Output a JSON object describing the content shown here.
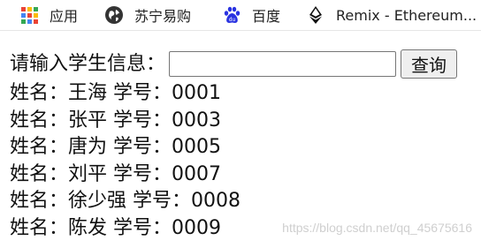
{
  "bookmarks": [
    {
      "icon": "apps-grid-icon",
      "label": "应用"
    },
    {
      "icon": "globe-icon",
      "label": "苏宁易购"
    },
    {
      "icon": "baidu-paw-icon",
      "label": "百度"
    },
    {
      "icon": "remix-icon",
      "label": "Remix - Ethereum..."
    }
  ],
  "form": {
    "label": "请输入学生信息：",
    "input_value": "",
    "button_label": "查询"
  },
  "students": [
    {
      "name_label": "姓名：",
      "name": "王海",
      "id_label": "学号：",
      "id": "0001"
    },
    {
      "name_label": "姓名：",
      "name": "张平",
      "id_label": "学号：",
      "id": "0003"
    },
    {
      "name_label": "姓名：",
      "name": "唐为",
      "id_label": "学号：",
      "id": "0005"
    },
    {
      "name_label": "姓名：",
      "name": "刘平",
      "id_label": "学号：",
      "id": "0007"
    },
    {
      "name_label": "姓名：",
      "name": "徐少强",
      "id_label": "学号：",
      "id": "0008"
    },
    {
      "name_label": "姓名：",
      "name": "陈发",
      "id_label": "学号：",
      "id": "0009"
    }
  ],
  "watermark": "https://blog.csdn.net/qq_45675616",
  "colors": {
    "apps_grid": [
      "#ea4335",
      "#fbbc05",
      "#34a853",
      "#4285f4"
    ],
    "baidu": "#2932e1",
    "globe": "#333333"
  }
}
